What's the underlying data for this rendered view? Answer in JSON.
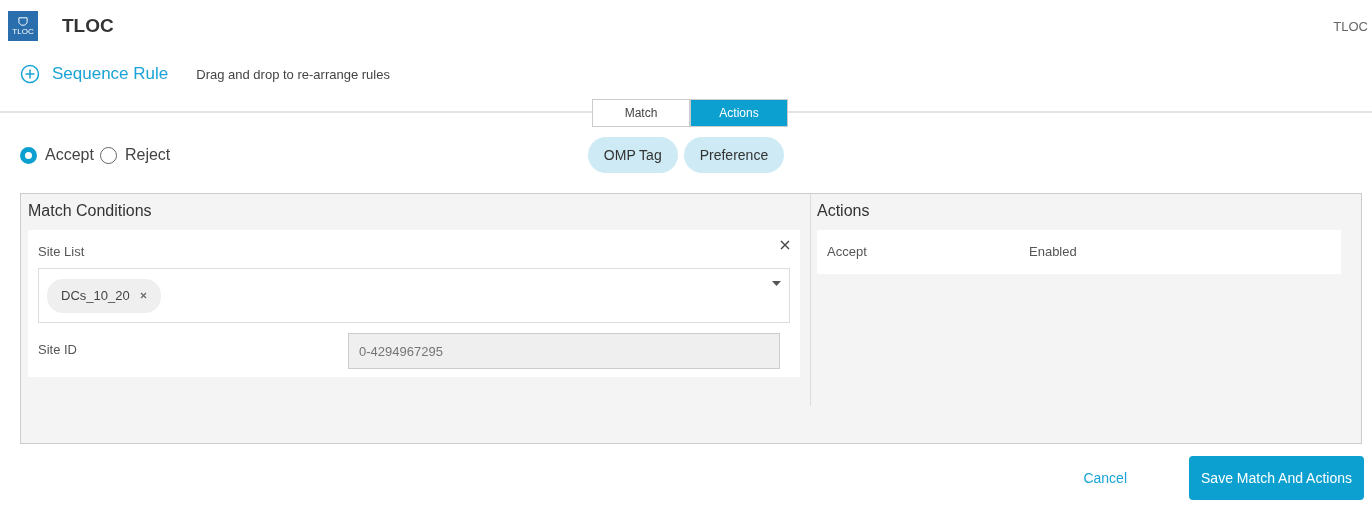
{
  "header": {
    "icon_label": "TLOC",
    "title": "TLOC",
    "breadcrumb": "TLOC"
  },
  "sequence": {
    "add_label": "Sequence Rule",
    "hint": "Drag and drop to re-arrange rules"
  },
  "tabs": [
    {
      "label": "Match",
      "selected": false
    },
    {
      "label": "Actions",
      "selected": true
    }
  ],
  "radios": [
    {
      "label": "Accept",
      "selected": true
    },
    {
      "label": "Reject",
      "selected": false
    }
  ],
  "action_chips": [
    "OMP Tag",
    "Preference"
  ],
  "match_conditions": {
    "title": "Match Conditions",
    "site_list": {
      "label": "Site List",
      "tags": [
        "DCs_10_20"
      ]
    },
    "site_id": {
      "label": "Site ID",
      "placeholder": "0-4294967295"
    }
  },
  "actions": {
    "title": "Actions",
    "rows": [
      {
        "name": "Accept",
        "value": "Enabled"
      }
    ]
  },
  "footer": {
    "cancel": "Cancel",
    "save": "Save Match And Actions"
  }
}
